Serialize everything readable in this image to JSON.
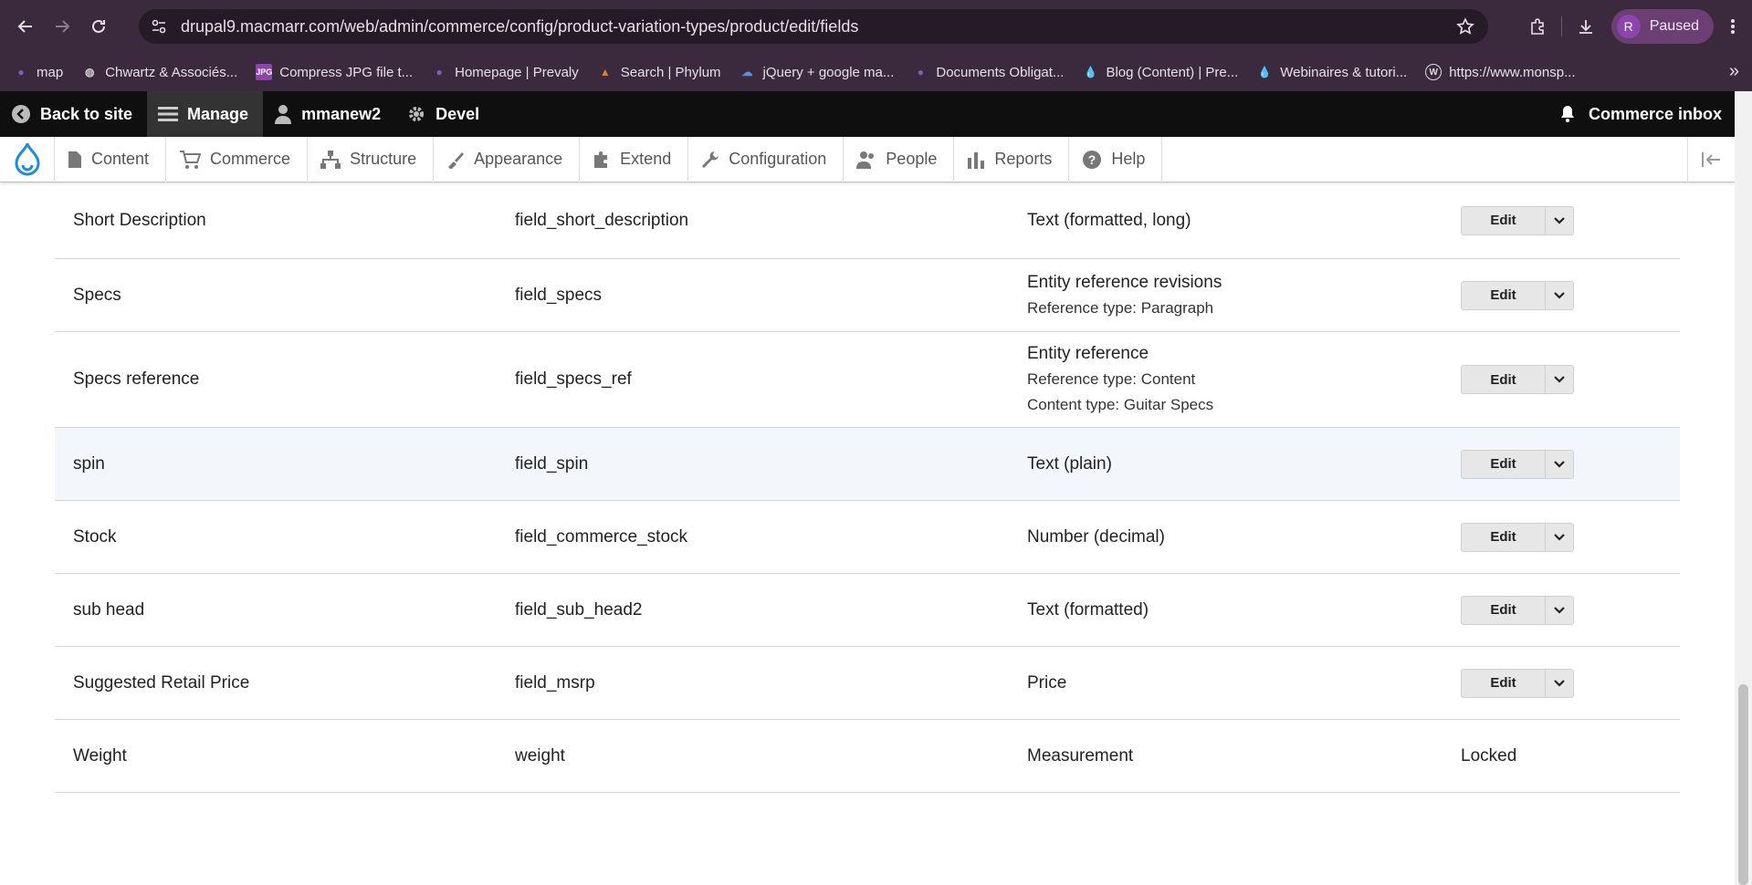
{
  "browser": {
    "url": "drupal9.macmarr.com/web/admin/commerce/config/product-variation-types/product/edit/fields",
    "profile_initial": "R",
    "profile_status": "Paused",
    "bookmarks": [
      {
        "label": "map",
        "icon": "blank-page-icon"
      },
      {
        "label": "Chwartz & Associés...",
        "icon": "globe-icon"
      },
      {
        "label": "Compress JPG file t...",
        "icon": "jpg-icon"
      },
      {
        "label": "Homepage | Prevaly",
        "icon": "leaf-icon"
      },
      {
        "label": "Search | Phylum",
        "icon": "phylum-icon"
      },
      {
        "label": "jQuery + google ma...",
        "icon": "cloud-icon"
      },
      {
        "label": "Documents Obligat...",
        "icon": "leaf-icon"
      },
      {
        "label": "Blog (Content) | Pre...",
        "icon": "drupal-icon"
      },
      {
        "label": "Webinaires & tutori...",
        "icon": "drupal-icon"
      },
      {
        "label": "https://www.monsp...",
        "icon": "wordpress-icon"
      }
    ]
  },
  "toolbar": {
    "back": "Back to site",
    "manage": "Manage",
    "user": "mmanew2",
    "devel": "Devel",
    "inbox": "Commerce inbox"
  },
  "tray": {
    "items": [
      "Content",
      "Commerce",
      "Structure",
      "Appearance",
      "Extend",
      "Configuration",
      "People",
      "Reports",
      "Help"
    ]
  },
  "fields": [
    {
      "label": "Short Description",
      "machine": "field_short_description",
      "type": "Text (formatted, long)",
      "sub": [],
      "op": "Edit"
    },
    {
      "label": "Specs",
      "machine": "field_specs",
      "type": "Entity reference revisions",
      "sub": [
        "Reference type: Paragraph"
      ],
      "op": "Edit"
    },
    {
      "label": "Specs reference",
      "machine": "field_specs_ref",
      "type": "Entity reference",
      "sub": [
        "Reference type: Content",
        "Content type: Guitar Specs"
      ],
      "op": "Edit"
    },
    {
      "label": "spin",
      "machine": "field_spin",
      "type": "Text (plain)",
      "sub": [],
      "op": "Edit"
    },
    {
      "label": "Stock",
      "machine": "field_commerce_stock",
      "type": "Number (decimal)",
      "sub": [],
      "op": "Edit"
    },
    {
      "label": "sub head",
      "machine": "field_sub_head2",
      "type": "Text (formatted)",
      "sub": [],
      "op": "Edit"
    },
    {
      "label": "Suggested Retail Price",
      "machine": "field_msrp",
      "type": "Price",
      "sub": [],
      "op": "Edit"
    },
    {
      "label": "Weight",
      "machine": "weight",
      "type": "Measurement",
      "sub": [],
      "op": "Locked"
    }
  ]
}
